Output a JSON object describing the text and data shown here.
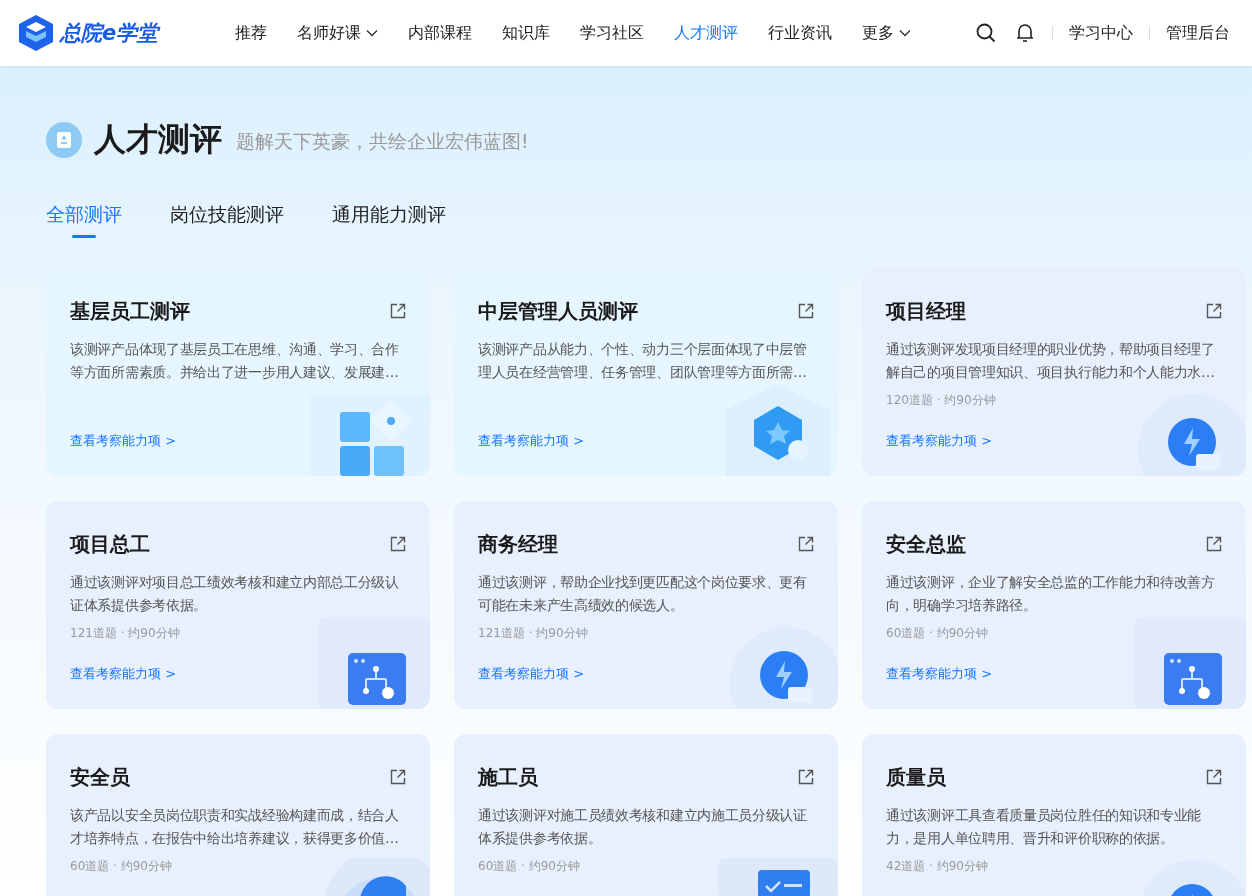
{
  "header": {
    "logo": "总院e学堂",
    "nav": [
      {
        "label": "推荐",
        "selected": false,
        "dropdown": false
      },
      {
        "label": "名师好课",
        "selected": false,
        "dropdown": true
      },
      {
        "label": "内部课程",
        "selected": false,
        "dropdown": false
      },
      {
        "label": "知识库",
        "selected": false,
        "dropdown": false
      },
      {
        "label": "学习社区",
        "selected": false,
        "dropdown": false
      },
      {
        "label": "人才测评",
        "selected": true,
        "dropdown": false
      },
      {
        "label": "行业资讯",
        "selected": false,
        "dropdown": false
      },
      {
        "label": "更多",
        "selected": false,
        "dropdown": true
      }
    ],
    "links": [
      "学习中心",
      "管理后台"
    ]
  },
  "hero": {
    "title": "人才测评",
    "subtitle": "题解天下英豪，共绘企业宏伟蓝图!"
  },
  "tabs": [
    {
      "label": "全部测评",
      "selected": true
    },
    {
      "label": "岗位技能测评",
      "selected": false
    },
    {
      "label": "通用能力测评",
      "selected": false
    }
  ],
  "cards": [
    {
      "title": "基层员工测评",
      "description": "该测评产品体现了基层员工在思维、沟通、学习、合作等方面所需素质。并给出了进一步用人建议、发展建…",
      "link": "查看考察能力项 >",
      "kind": "blocks"
    },
    {
      "title": "中层管理人员测评",
      "description": "该测评产品从能力、个性、动力三个层面体现了中层管理人员在经营管理、任务管理、团队管理等方面所需…",
      "link": "查看考察能力项 >",
      "kind": "hexagon"
    },
    {
      "title": "项目经理",
      "description": "通过该测评发现项目经理的职业优势，帮助项目经理了解自己的项目管理知识、项目执行能力和个人能力水…",
      "meta": "120道题 · 约90分钟",
      "link": "查看考察能力项 >",
      "kind": "bulb"
    },
    {
      "title": "项目总工",
      "description": "通过该测评对项目总工绩效考核和建立内部总工分级认证体系提供参考依据。",
      "meta": "121道题 · 约90分钟",
      "link": "查看考察能力项 >",
      "kind": "flow"
    },
    {
      "title": "商务经理",
      "description": "通过该测评，帮助企业找到更匹配这个岗位要求、更有可能在未来产生高绩效的候选人。",
      "meta": "121道题 · 约90分钟",
      "link": "查看考察能力项 >",
      "kind": "bulb"
    },
    {
      "title": "安全总监",
      "description": "通过该测评，企业了解安全总监的工作能力和待改善方向，明确学习培养路径。",
      "meta": "60道题 · 约90分钟",
      "link": "查看考察能力项 >",
      "kind": "flow"
    },
    {
      "title": "安全员",
      "description": "该产品以安全员岗位职责和实战经验构建而成，结合人才培养特点，在报告中给出培养建议，获得更多价值…",
      "meta": "60道题 · 约90分钟",
      "kind": "target"
    },
    {
      "title": "施工员",
      "description": "通过该测评对施工员绩效考核和建立内施工员分级认证体系提供参考依据。",
      "meta": "60道题 · 约90分钟",
      "kind": "clipboard"
    },
    {
      "title": "质量员",
      "description": "通过该测评工具查看质量员岗位胜任的知识和专业能力，是用人单位聘用、晋升和评价职称的依据。",
      "meta": "42道题 · 约90分钟",
      "kind": "bulb"
    }
  ]
}
